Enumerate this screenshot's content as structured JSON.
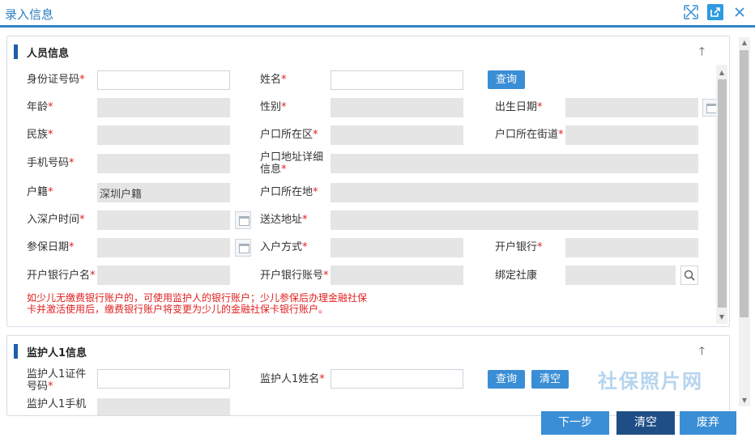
{
  "window": {
    "title": "录入信息",
    "icons": [
      "fullscreen-icon",
      "external-link-icon",
      "close-icon"
    ]
  },
  "section1": {
    "title": "人员信息",
    "fields": {
      "id_number": {
        "label": "身份证号码",
        "req": "*",
        "value": ""
      },
      "name": {
        "label": "姓名",
        "req": "*",
        "value": ""
      },
      "age": {
        "label": "年龄",
        "req": "*",
        "value": ""
      },
      "gender": {
        "label": "性别",
        "req": "*",
        "value": ""
      },
      "birth_date": {
        "label": "出生日期",
        "req": "*",
        "value": ""
      },
      "ethnicity": {
        "label": "民族",
        "req": "*",
        "value": ""
      },
      "hukou_district": {
        "label": "户口所在区",
        "req": "*",
        "value": ""
      },
      "hukou_street": {
        "label": "户口所在街道",
        "req": "*",
        "value": ""
      },
      "mobile": {
        "label": "手机号码",
        "req": "*",
        "value": ""
      },
      "hukou_address_line1": {
        "label": "户口地址详细",
        "value": ""
      },
      "hukou_address_line2": {
        "label": "信息",
        "req": "*"
      },
      "household_type": {
        "label": "户籍",
        "req": "*",
        "value": "深圳户籍"
      },
      "hukou_location": {
        "label": "户口所在地",
        "req": "*",
        "value": ""
      },
      "sz_hukou_time": {
        "label": "入深户时间",
        "req": "*",
        "value": ""
      },
      "delivery_address": {
        "label": "送达地址",
        "req": "*",
        "value": ""
      },
      "insured_date": {
        "label": "参保日期",
        "req": "*",
        "value": ""
      },
      "entry_method": {
        "label": "入户方式",
        "req": "*",
        "value": ""
      },
      "bank": {
        "label": "开户银行",
        "req": "*",
        "value": ""
      },
      "bank_account_name": {
        "label": "开户银行户名",
        "req": "*",
        "value": ""
      },
      "bank_account_no": {
        "label": "开户银行账号",
        "req": "*",
        "value": ""
      },
      "bind_shekang": {
        "label": "绑定社康",
        "value": ""
      }
    },
    "query_button": "查询",
    "note": "如少儿无缴费银行账户的，可使用监护人的银行账户；少儿参保后办理金融社保卡并激活使用后，缴费银行账户将变更为少儿的金融社保卡银行账户。"
  },
  "section2": {
    "title": "监护人1信息",
    "fields": {
      "guardian_id_line1": {
        "label": "监护人1证件"
      },
      "guardian_id_line2": {
        "label": "号码",
        "req": "*",
        "value": ""
      },
      "guardian_name": {
        "label": "监护人1姓名",
        "req": "*",
        "value": ""
      },
      "guardian_mobile": {
        "label": "监护人1手机",
        "value": ""
      }
    },
    "query_button": "查询",
    "clear_button": "清空"
  },
  "watermark": "社保照片网",
  "footer": {
    "next": "下一步",
    "clear": "清空",
    "discard": "废弃"
  },
  "colors": {
    "accent": "#3a8ed6",
    "dark_button": "#1f4e86",
    "required": "#e02020",
    "disabled_field": "#e5e5e5"
  }
}
